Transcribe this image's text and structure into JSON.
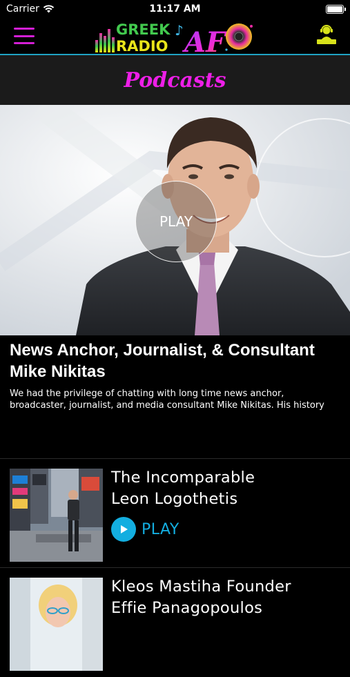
{
  "status_bar": {
    "carrier": "Carrier",
    "time": "11:17 AM"
  },
  "header": {
    "logo_top": "GREEK",
    "logo_bottom": "RADIO",
    "logo_mark": "AF"
  },
  "page": {
    "title": "Podcasts"
  },
  "featured": {
    "play_label": "PLAY",
    "title": "News Anchor, Journalist, & Consultant Mike Nikitas",
    "description": "We had the privilege of chatting with long time news anchor, broadcaster, journalist, and media consultant Mike Nikitas. His history leading up to to..."
  },
  "episodes": [
    {
      "title_line1": "The Incomparable",
      "title_line2": "Leon Logothetis",
      "play_label": "PLAY"
    },
    {
      "title_line1": "Kleos Mastiha Founder",
      "title_line2": "Effie Panagopoulos"
    }
  ],
  "colors": {
    "accent": "#13aee0",
    "title": "#ee1fe8",
    "menu": "#d41fd6",
    "dj": "#d8e21a"
  }
}
